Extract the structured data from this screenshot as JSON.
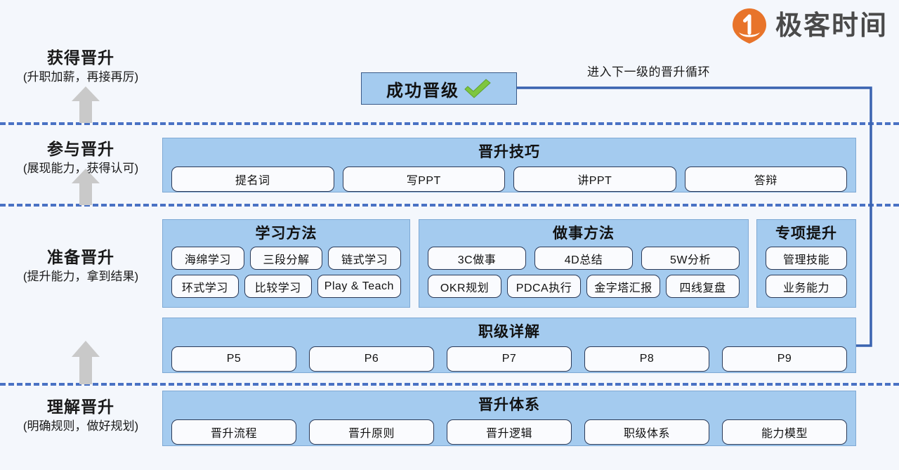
{
  "brand": {
    "logo_name": "geektime-logo-icon",
    "name": "极客时间",
    "mark_color": "#e8742a"
  },
  "colors": {
    "background": "#f4f7fc",
    "panel_fill": "#a4cbef",
    "panel_border": "#7fa9d4",
    "chip_fill": "#fafbfe",
    "chip_border": "#2b3a58",
    "divider": "#4a72c4",
    "arrow_gray": "#c9c9c9",
    "loop_arrow": "#3a63b0",
    "check_green": "#7ec63f"
  },
  "stages": [
    {
      "title": "获得晋升",
      "subtitle": "(升职加薪，再接再厉)"
    },
    {
      "title": "参与晋升",
      "subtitle": "(展现能力，获得认可)"
    },
    {
      "title": "准备晋升",
      "subtitle": "(提升能力，拿到结果)"
    },
    {
      "title": "理解晋升",
      "subtitle": "(明确规则，做好规划)"
    }
  ],
  "success": {
    "label": "成功晋级",
    "check_icon": "green-check-icon"
  },
  "cycle": {
    "label": "进入下一级的晋升循环"
  },
  "panels": {
    "promotion_skills": {
      "title": "晋升技巧",
      "items": [
        "提名词",
        "写PPT",
        "讲PPT",
        "答辩"
      ]
    },
    "learning_methods": {
      "title": "学习方法",
      "row1": [
        "海绵学习",
        "三段分解",
        "链式学习"
      ],
      "row2": [
        "环式学习",
        "比较学习",
        "Play & Teach"
      ]
    },
    "work_methods": {
      "title": "做事方法",
      "row1": [
        "3C做事",
        "4D总结",
        "5W分析"
      ],
      "row2": [
        "OKR规划",
        "PDCA执行",
        "金字塔汇报",
        "四线复盘"
      ]
    },
    "special_improvement": {
      "title": "专项提升",
      "row1": [
        "管理技能"
      ],
      "row2": [
        "业务能力"
      ]
    },
    "level_details": {
      "title": "职级详解",
      "items": [
        "P5",
        "P6",
        "P7",
        "P8",
        "P9"
      ]
    },
    "promotion_system": {
      "title": "晋升体系",
      "items": [
        "晋升流程",
        "晋升原则",
        "晋升逻辑",
        "职级体系",
        "能力模型"
      ]
    }
  }
}
